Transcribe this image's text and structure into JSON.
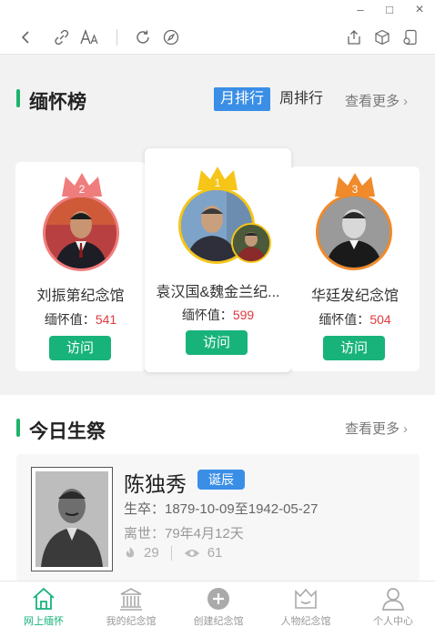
{
  "window": {
    "min": "–",
    "max": "□",
    "close": "×"
  },
  "section_rank": {
    "title": "缅怀榜",
    "tab_month": "月排行",
    "tab_week": "周排行",
    "more": "查看更多",
    "cards": [
      {
        "rank": "2",
        "name": "刘振第纪念馆",
        "value_label": "缅怀值：",
        "value": "541",
        "visit": "访问",
        "crown_color": "#f07d7d"
      },
      {
        "rank": "1",
        "name": "袁汉国&魏金兰纪...",
        "value_label": "缅怀值：",
        "value": "599",
        "visit": "访问",
        "crown_color": "#f5c518"
      },
      {
        "rank": "3",
        "name": "华廷发纪念馆",
        "value_label": "缅怀值：",
        "value": "504",
        "visit": "访问",
        "crown_color": "#f08a2a"
      }
    ]
  },
  "section_today": {
    "title": "今日生祭",
    "more": "查看更多",
    "person": {
      "name": "陈独秀",
      "badge": "诞辰",
      "lifespan": "生卒：1879-10-09至1942-05-27",
      "passed": "离世：79年4月12天",
      "flowers": "29",
      "views": "61"
    }
  },
  "nav": [
    {
      "label": "网上缅怀",
      "icon": "home-icon",
      "active": true
    },
    {
      "label": "我的纪念馆",
      "icon": "memorial-hall-icon",
      "active": false
    },
    {
      "label": "创建纪念馆",
      "icon": "plus-circle-icon",
      "active": false
    },
    {
      "label": "人物纪念馆",
      "icon": "person-memorial-icon",
      "active": false
    },
    {
      "label": "个人中心",
      "icon": "user-icon",
      "active": false
    }
  ],
  "colors": {
    "accent_green": "#18b37b",
    "accent_blue": "#3a8ee6",
    "value_red": "#e0393e"
  }
}
